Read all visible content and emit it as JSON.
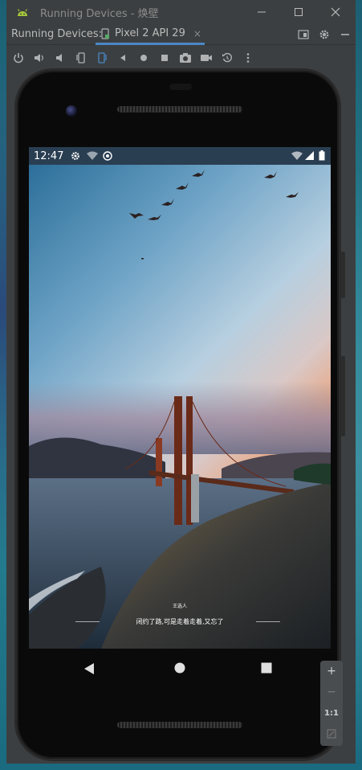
{
  "window": {
    "title": "Running Devices - 焕壁",
    "minimize_icon": "minimize-icon",
    "maximize_icon": "maximize-icon",
    "close_icon": "close-icon"
  },
  "tabbar": {
    "label": "Running Devices:",
    "tab_label": "Pixel 2 API 29",
    "tab_close": "×"
  },
  "toolbar": {
    "buttons": [
      "power-icon",
      "volume-up-icon",
      "volume-down-icon",
      "rotate-left-icon",
      "rotate-right-icon",
      "back-icon",
      "home-icon",
      "overview-icon",
      "screenshot-icon",
      "screen-record-icon",
      "snapshot-icon",
      "more-icon"
    ]
  },
  "device": {
    "status_time": "12:47",
    "caption_sub": "王选人",
    "caption": "闭约了路,可是走着走着,又忘了"
  },
  "zoom": {
    "zoom_in": "+",
    "zoom_out": "−",
    "actual": "1:1",
    "fit": "fit-screen-icon"
  },
  "colors": {
    "ide_bg": "#3c3f41",
    "tab_accent": "#4a88c7",
    "android_green": "#a4c639"
  }
}
